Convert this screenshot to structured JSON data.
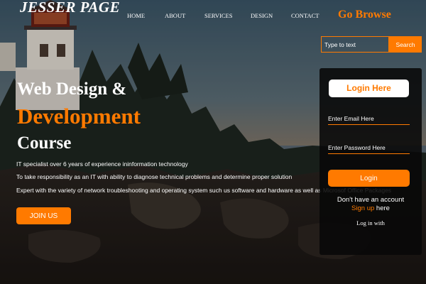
{
  "brand": {
    "name": "JESSER PAGE"
  },
  "nav": {
    "items": [
      "HOME",
      "ABOUT",
      "SERVICES",
      "DESIGN",
      "CONTACT"
    ],
    "go_browse": "Go Browse"
  },
  "search": {
    "placeholder": "Type to text",
    "button_label": "Search"
  },
  "hero": {
    "title_line1": "Web Design &",
    "title_line2": "Development",
    "title_line3": "Course",
    "paragraphs": [
      "IT specialist over 6 years of experience ininformation technology",
      "To take responsibility as an IT with ability to diagnose technical problems and determine proper solution",
      "Expert with the variety of network troubleshooting and operating system such us software and hardware as well as Microsof Office Packages"
    ],
    "join_label": "JOIN US"
  },
  "login": {
    "heading": "Login Here",
    "email_placeholder": "Enter Email Here",
    "password_placeholder": "Enter Password Here",
    "button_label": "Login",
    "no_account": "Don't have an account",
    "signup_link": "Sign up",
    "signup_suffix": " here",
    "login_with": "Log in with"
  },
  "colors": {
    "accent": "#ff7a00",
    "text": "#ffffff",
    "panel": "#080808"
  }
}
